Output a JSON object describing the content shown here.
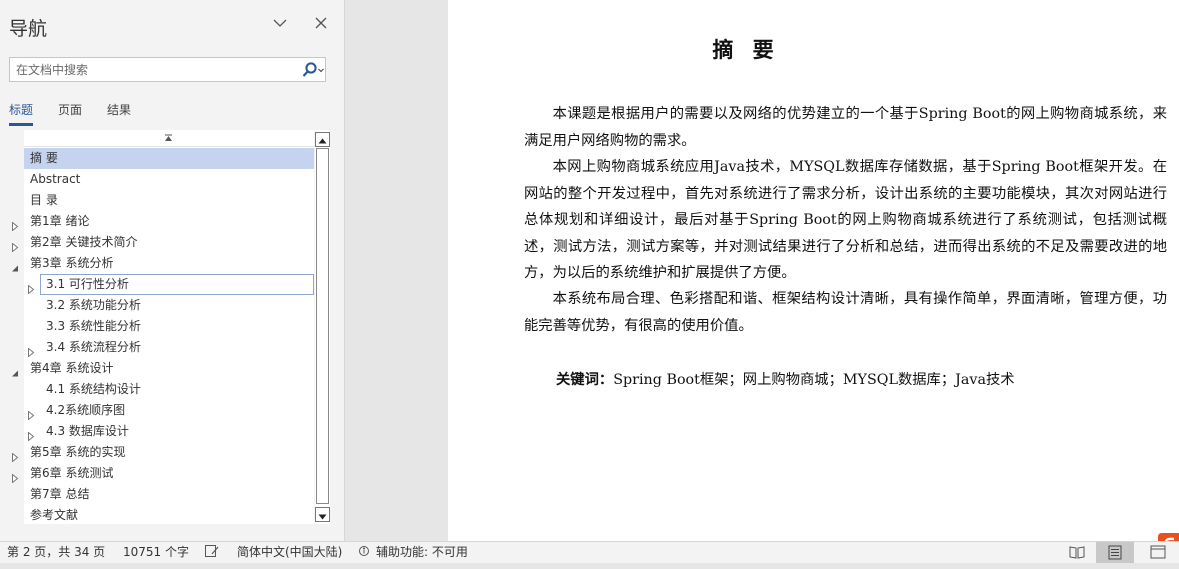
{
  "nav": {
    "title": "导航",
    "search_placeholder": "在文档中搜索",
    "tabs": [
      "标题",
      "页面",
      "结果"
    ],
    "items": [
      {
        "label": "摘  要",
        "level": 1,
        "expander": "none",
        "state": "selected"
      },
      {
        "label": "Abstract",
        "level": 1,
        "expander": "none"
      },
      {
        "label": "目  录",
        "level": 1,
        "expander": "none"
      },
      {
        "label": "第1章 绪论",
        "level": 1,
        "expander": "collapsed"
      },
      {
        "label": "第2章  关键技术简介",
        "level": 1,
        "expander": "collapsed"
      },
      {
        "label": "第3章 系统分析",
        "level": 1,
        "expander": "expanded"
      },
      {
        "label": "3.1 可行性分析",
        "level": 2,
        "expander": "collapsed",
        "state": "focused"
      },
      {
        "label": "3.2 系统功能分析",
        "level": 2,
        "expander": "none"
      },
      {
        "label": "3.3 系统性能分析",
        "level": 2,
        "expander": "none"
      },
      {
        "label": "3.4 系统流程分析",
        "level": 2,
        "expander": "collapsed"
      },
      {
        "label": "第4章  系统设计",
        "level": 1,
        "expander": "expanded"
      },
      {
        "label": "4.1 系统结构设计",
        "level": 2,
        "expander": "none"
      },
      {
        "label": "4.2系统顺序图",
        "level": 2,
        "expander": "collapsed"
      },
      {
        "label": "4.3 数据库设计",
        "level": 2,
        "expander": "collapsed"
      },
      {
        "label": "第5章  系统的实现",
        "level": 1,
        "expander": "collapsed"
      },
      {
        "label": "第6章 系统测试",
        "level": 1,
        "expander": "collapsed"
      },
      {
        "label": "第7章 总结",
        "level": 1,
        "expander": "none"
      },
      {
        "label": "参考文献",
        "level": 1,
        "expander": "none"
      }
    ]
  },
  "document": {
    "title": "摘  要",
    "paragraphs": [
      "本课题是根据用户的需要以及网络的优势建立的一个基于Spring Boot的网上购物商城系统，来满足用户网络购物的需求。",
      "本网上购物商城系统应用Java技术，MYSQL数据库存储数据，基于Spring Boot框架开发。在网站的整个开发过程中，首先对系统进行了需求分析，设计出系统的主要功能模块，其次对网站进行总体规划和详细设计，最后对基于Spring Boot的网上购物商城系统进行了系统测试，包括测试概述，测试方法，测试方案等，并对测试结果进行了分析和总结，进而得出系统的不足及需要改进的地方，为以后的系统维护和扩展提供了方便。",
      "本系统布局合理、色彩搭配和谐、框架结构设计清晰，具有操作简单，界面清晰，管理方便，功能完善等优势，有很高的使用价值。"
    ],
    "keywords_label": "关键词：",
    "keywords": "Spring Boot框架；网上购物商城；MYSQL数据库；Java技术"
  },
  "status": {
    "page": "第 2 页，共 34 页",
    "words": "10751 个字",
    "language": "简体中文(中国大陆)",
    "accessibility": "辅助功能: 不可用"
  },
  "colors": {
    "accent": "#2b579a",
    "selected": "#c5d3ee",
    "wps": "#e8501e"
  }
}
